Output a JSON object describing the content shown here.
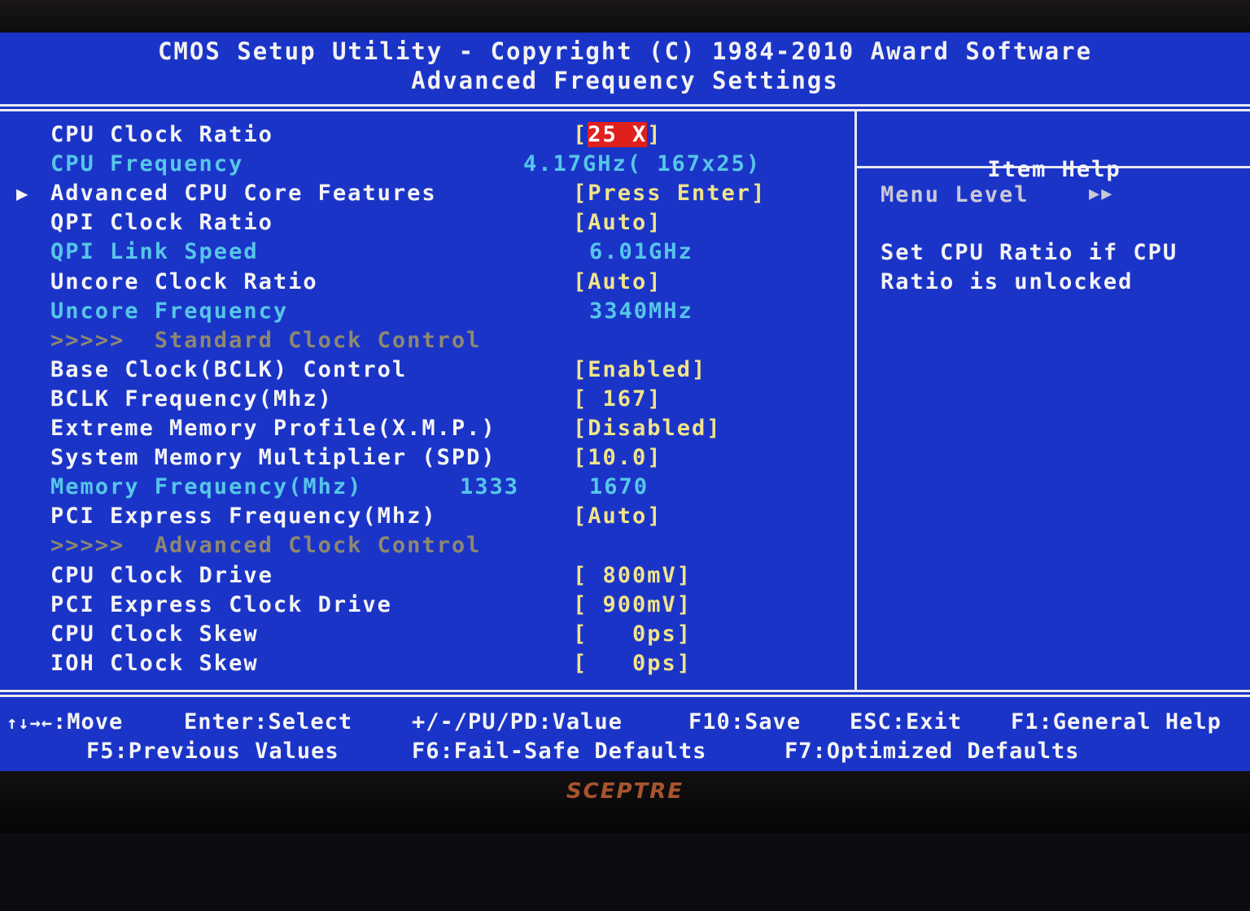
{
  "header": {
    "title": "CMOS Setup Utility - Copyright (C) 1984-2010 Award Software",
    "subtitle": "Advanced Frequency Settings"
  },
  "items": [
    {
      "label": "CPU Clock Ratio",
      "value": "25 X",
      "style": "white",
      "selected": true
    },
    {
      "label": "CPU Frequency",
      "value": "4.17GHz( 167x25)",
      "style": "cyan"
    },
    {
      "label": "Advanced CPU Core Features",
      "value": "[Press Enter]",
      "style": "white",
      "submenu": true,
      "pointer": "▶"
    },
    {
      "label": "QPI Clock Ratio",
      "value": "[Auto]",
      "style": "white"
    },
    {
      "label": "QPI Link Speed",
      "value": "6.01GHz",
      "style": "cyan"
    },
    {
      "label": "Uncore Clock Ratio",
      "value": "[Auto]",
      "style": "white"
    },
    {
      "label": "Uncore Frequency",
      "value": "3340MHz",
      "style": "cyan"
    },
    {
      "label": ">>>>>  Standard Clock Control",
      "value": "",
      "style": "dim"
    },
    {
      "label": "Base Clock(BCLK) Control",
      "value": "[Enabled]",
      "style": "white"
    },
    {
      "label": "BCLK Frequency(Mhz)",
      "value": "[ 167]",
      "style": "white"
    },
    {
      "label": "Extreme Memory Profile(X.M.P.)",
      "value": "[Disabled]",
      "style": "white"
    },
    {
      "label": "System Memory Multiplier (SPD)",
      "value": "[10.0]",
      "style": "white"
    },
    {
      "label": "Memory Frequency(Mhz)",
      "extra": "1333",
      "value": "1670",
      "style": "cyan"
    },
    {
      "label": "PCI Express Frequency(Mhz)",
      "value": "[Auto]",
      "style": "white"
    },
    {
      "label": ">>>>>  Advanced Clock Control",
      "value": "",
      "style": "dim"
    },
    {
      "label": "CPU Clock Drive",
      "value": "[ 800mV]",
      "style": "white"
    },
    {
      "label": "PCI Express Clock Drive",
      "value": "[ 900mV]",
      "style": "white"
    },
    {
      "label": "CPU Clock Skew",
      "value": "[   0ps]",
      "style": "white"
    },
    {
      "label": "IOH Clock Skew",
      "value": "[   0ps]",
      "style": "white"
    }
  ],
  "item_help": {
    "title": "Item Help",
    "menu_level_label": "Menu Level",
    "menu_level_value": "▶▶",
    "help_line1": "Set CPU Ratio if CPU",
    "help_line2": "Ratio is unlocked"
  },
  "footer": {
    "row1": [
      {
        "key": "↑↓→←",
        "action": "Move"
      },
      {
        "key": "Enter",
        "action": "Select"
      },
      {
        "key": "+/-/PU/PD",
        "action": "Value"
      },
      {
        "key": "F10",
        "action": "Save"
      },
      {
        "key": "ESC",
        "action": "Exit"
      },
      {
        "key": "F1",
        "action": "General Help"
      }
    ],
    "row2": [
      {
        "key": "F5",
        "action": "Previous Values"
      },
      {
        "key": "F6",
        "action": "Fail-Safe Defaults"
      },
      {
        "key": "F7",
        "action": "Optimized Defaults"
      }
    ]
  },
  "brand": "SCEPTRE",
  "colors": {
    "background": "#1b34c8",
    "selection": "#e0201c",
    "label": "#f4f4f4",
    "readonly": "#56c6e8",
    "value": "#f0e48a",
    "disabled_section": "#8e8870"
  }
}
